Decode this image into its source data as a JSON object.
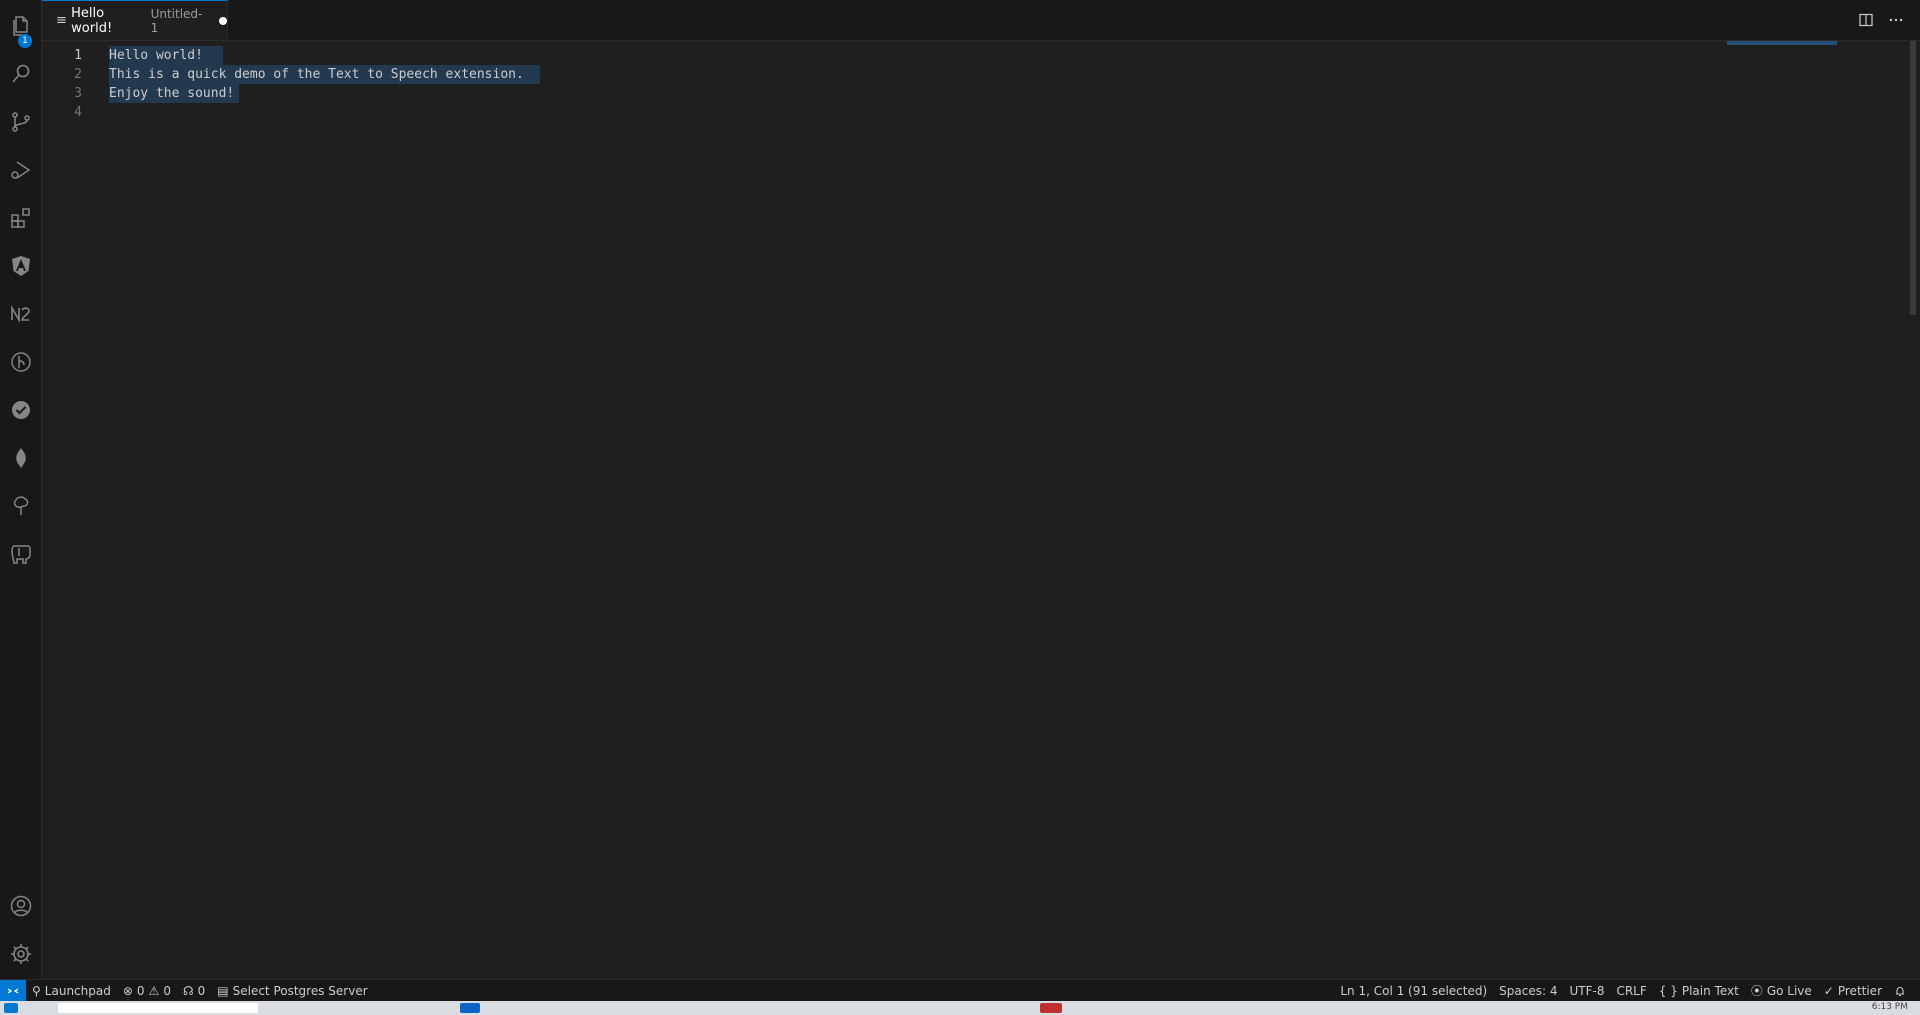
{
  "tab": {
    "title": "Hello world!",
    "description": "Untitled-1"
  },
  "activity_bar": {
    "explorer_badge": "1",
    "icons": [
      "files-icon",
      "search-icon",
      "source-control-icon",
      "run-debug-icon",
      "extensions-icon",
      "angular-icon",
      "n2-icon",
      "gitlens-icon",
      "check-icon",
      "leaf-icon",
      "tree-icon",
      "elephant-icon",
      "account-icon",
      "gear-icon"
    ]
  },
  "editor": {
    "lines": [
      {
        "number": "1",
        "text": "Hello world!"
      },
      {
        "number": "2",
        "text": "This is a quick demo of the Text to Speech extension."
      },
      {
        "number": "3",
        "text": "Enjoy the sound!"
      },
      {
        "number": "4",
        "text": ""
      }
    ]
  },
  "status_bar": {
    "launchpad": "Launchpad",
    "errors": "0",
    "warnings": "0",
    "ports": "0",
    "postgres": "Select Postgres Server",
    "cursor": "Ln 1, Col 1 (91 selected)",
    "spaces": "Spaces: 4",
    "encoding": "UTF-8",
    "eol": "CRLF",
    "language": "Plain Text",
    "golive": "Go Live",
    "prettier": "Prettier"
  },
  "taskbar": {
    "clock": "6:13 PM"
  },
  "colors": {
    "accent": "#0078d4",
    "editor_bg": "#1f1f1f",
    "bar_bg": "#181818"
  }
}
